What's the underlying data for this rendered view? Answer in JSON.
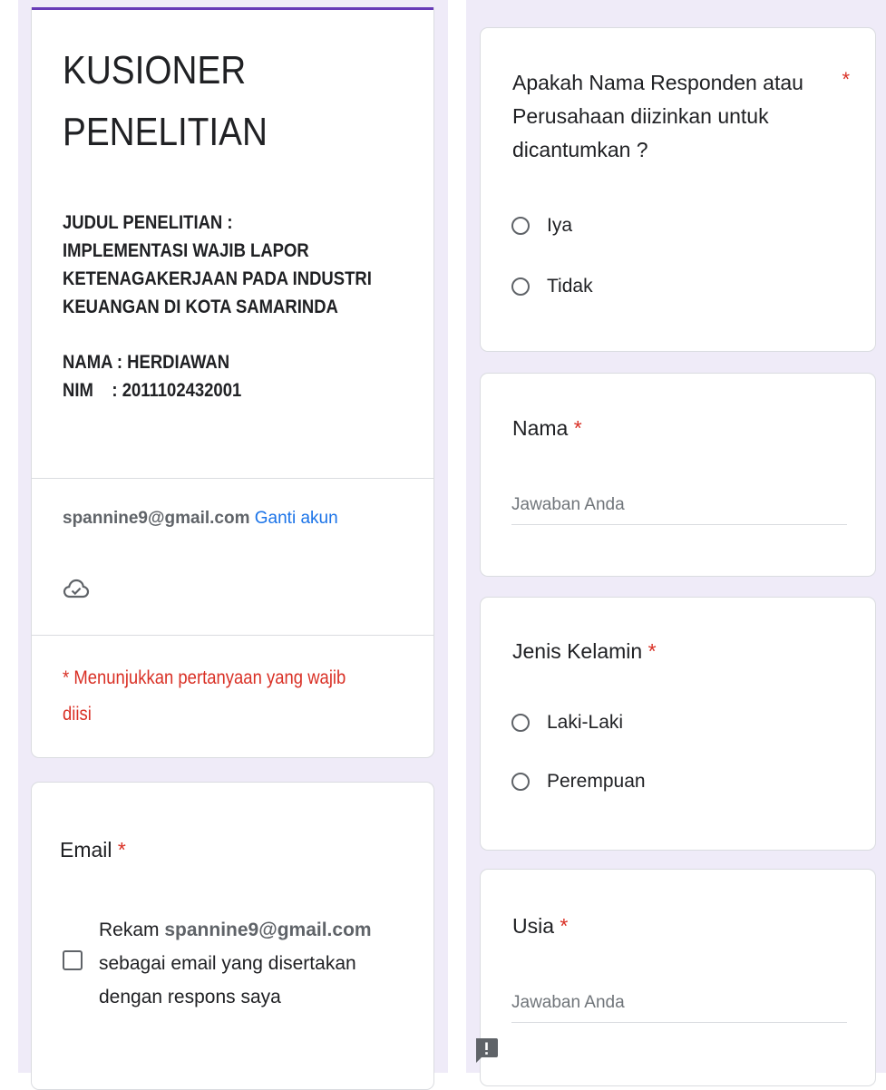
{
  "header": {
    "title_line1": "KUSIONER",
    "title_line2": "PENELITIAN",
    "desc_lines": [
      "JUDUL PENELITIAN :",
      "IMPLEMENTASI WAJIB LAPOR",
      "KETENAGAKERJAAN PADA INDUSTRI",
      "KEUANGAN DI KOTA SAMARINDA"
    ],
    "name_line": "NAMA : HERDIAWAN",
    "nim_line": "NIM    : 2011102432001",
    "account_email": "spannine9@gmail.com",
    "switch_account": "Ganti akun",
    "required_note_line1": "* Menunjukkan pertanyaan yang wajib",
    "required_note_line2": "diisi"
  },
  "email_question": {
    "label": "Email",
    "asterisk": "*",
    "checkbox_prefix": "Rekam",
    "checkbox_email": "spannine9@gmail.com",
    "checkbox_line2": "sebagai email yang disertakan",
    "checkbox_line3": "dengan respons saya"
  },
  "questions": {
    "consent": {
      "title_lines": [
        "Apakah Nama Responden atau",
        "Perusahaan diizinkan untuk",
        "dicantumkan ?"
      ],
      "asterisk": "*",
      "options": [
        "Iya",
        "Tidak"
      ]
    },
    "name": {
      "label": "Nama",
      "asterisk": "*",
      "placeholder": "Jawaban Anda"
    },
    "gender": {
      "label": "Jenis Kelamin",
      "asterisk": "*",
      "options": [
        "Laki-Laki",
        "Perempuan"
      ]
    },
    "age": {
      "label": "Usia",
      "asterisk": "*",
      "placeholder": "Jawaban Anda"
    }
  },
  "colors": {
    "accent_purple": "#673ab7",
    "required_red": "#d93025",
    "link_blue": "#1a73e8",
    "background": "#efebf8"
  },
  "icons": {
    "cloud": "cloud-check-icon",
    "feedback": "report-issue-icon"
  }
}
